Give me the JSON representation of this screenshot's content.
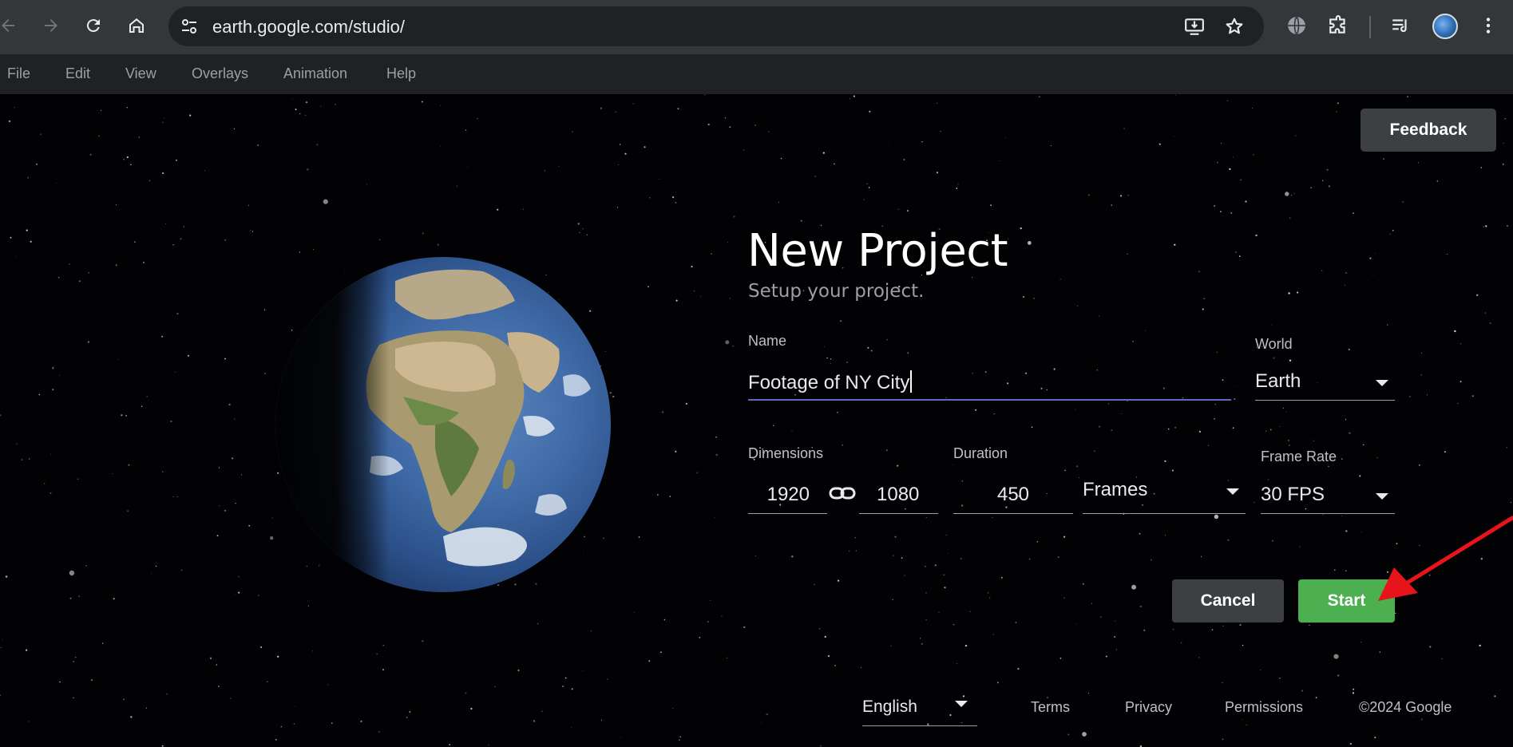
{
  "browser": {
    "url": "earth.google.com/studio/"
  },
  "menu": {
    "items": [
      "File",
      "Edit",
      "View",
      "Overlays",
      "Animation",
      "Help"
    ]
  },
  "feedback_label": "Feedback",
  "project": {
    "title": "New Project",
    "subtitle": "Setup your project.",
    "name_label": "Name",
    "name_value": "Footage of NY City",
    "world_label": "World",
    "world_value": "Earth",
    "dimensions_label": "Dimensions",
    "width_value": "1920",
    "height_value": "1080",
    "duration_label": "Duration",
    "duration_value": "450",
    "duration_unit": "Frames",
    "frame_rate_label": "Frame Rate",
    "frame_rate_value": "30 FPS",
    "cancel_label": "Cancel",
    "start_label": "Start"
  },
  "footer": {
    "language": "English",
    "terms": "Terms",
    "privacy": "Privacy",
    "permissions": "Permissions",
    "copyright": "©2024 Google"
  },
  "colors": {
    "start_button": "#4caf50",
    "annotation_arrow": "#e8141c",
    "active_underline": "#5c6bc0"
  }
}
